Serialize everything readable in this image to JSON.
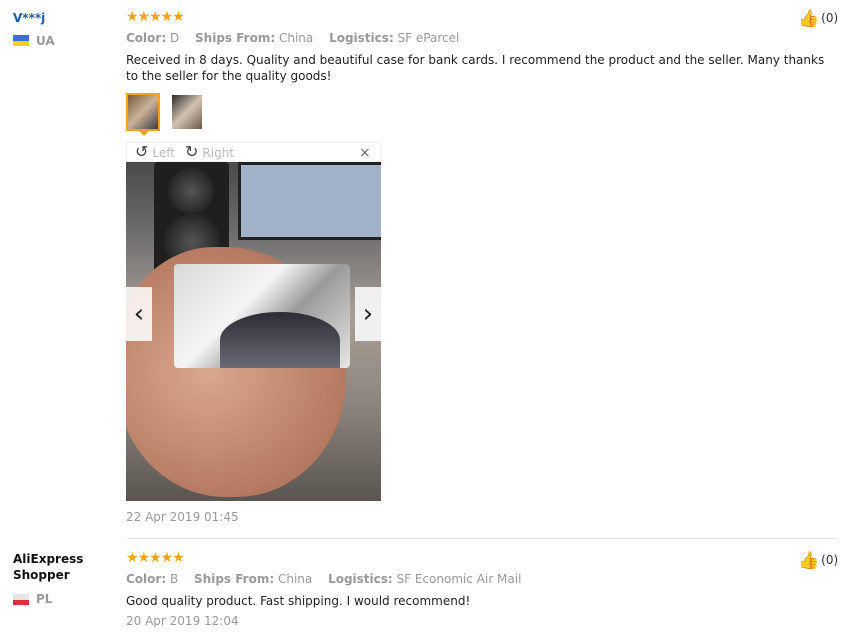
{
  "reviews": [
    {
      "user": "V***j",
      "country": "UA",
      "stars": "★★★★★",
      "color_label": "Color:",
      "color_value": "D",
      "ships_label": "Ships From:",
      "ships_value": "China",
      "logistics_label": "Logistics:",
      "logistics_value": "SF eParcel",
      "feedback": "Received in 8 days. Quality and beautiful case for bank cards. I recommend the product and the seller. Many thanks to the seller for the quality goods!",
      "date": "22 Apr 2019 01:45",
      "likes": "(0)"
    },
    {
      "user": "AliExpress Shopper",
      "country": "PL",
      "stars": "★★★★★",
      "color_label": "Color:",
      "color_value": "B",
      "ships_label": "Ships From:",
      "ships_value": "China",
      "logistics_label": "Logistics:",
      "logistics_value": "SF Economic Air Mail",
      "feedback": "Good quality product. Fast shipping. I would recommend!",
      "date": "20 Apr 2019 12:04",
      "likes": "(0)"
    }
  ],
  "viewer": {
    "rotate_left_label": "Left",
    "rotate_right_label": "Right",
    "close_glyph": "×",
    "rotate_left_glyph": "↺",
    "rotate_right_glyph": "↻",
    "prev_glyph": "‹",
    "next_glyph": "›"
  },
  "icons": {
    "like": "thumbs-up-icon",
    "rotate_left": "rotate-left-icon",
    "rotate_right": "rotate-right-icon",
    "close": "close-icon",
    "prev": "chevron-left-icon",
    "next": "chevron-right-icon"
  },
  "colors": {
    "username_link": "#1a5aa8",
    "stars": "#f7a11a",
    "active_thumb": "#f6a21e"
  }
}
